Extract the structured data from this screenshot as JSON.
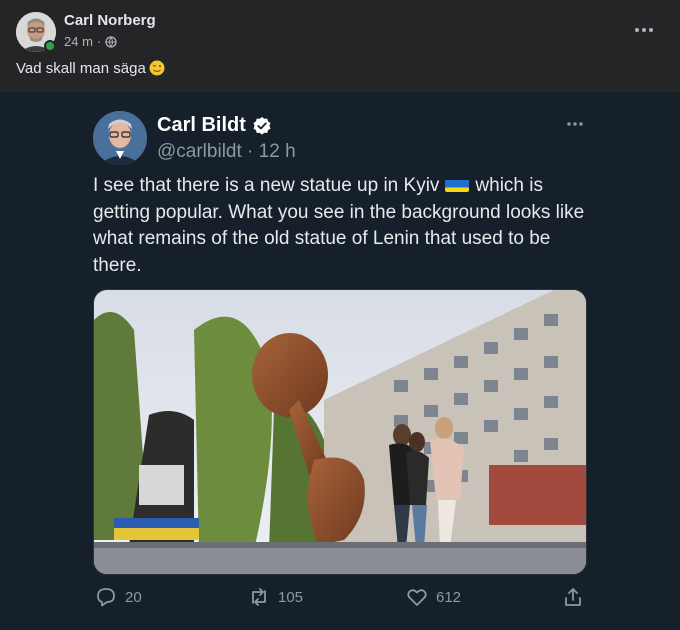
{
  "post": {
    "author": "Carl Norberg",
    "time": "24 m",
    "visibility_separator": "·",
    "caption": "Vad skall man säga",
    "caption_emoji": "wink-face-emoji",
    "menu_icon": "more-horizontal-icon"
  },
  "tweet": {
    "name": "Carl Bildt",
    "verified": true,
    "handle": "@carlbildt",
    "time": "12 h",
    "text_part1": "I see that there is a new statue up in Kyiv",
    "flag": "ukraine-flag-emoji",
    "text_part2": "which is getting popular. What you see in the background looks like what remains of the old statue of Lenin that used to be there.",
    "stats": {
      "replies": "20",
      "retweets": "105",
      "likes": "612"
    }
  },
  "colors": {
    "facebook_bg": "#242526",
    "tweet_bg": "#15202b",
    "online_green": "#31a24c",
    "twitter_gray": "#8b98a5"
  }
}
